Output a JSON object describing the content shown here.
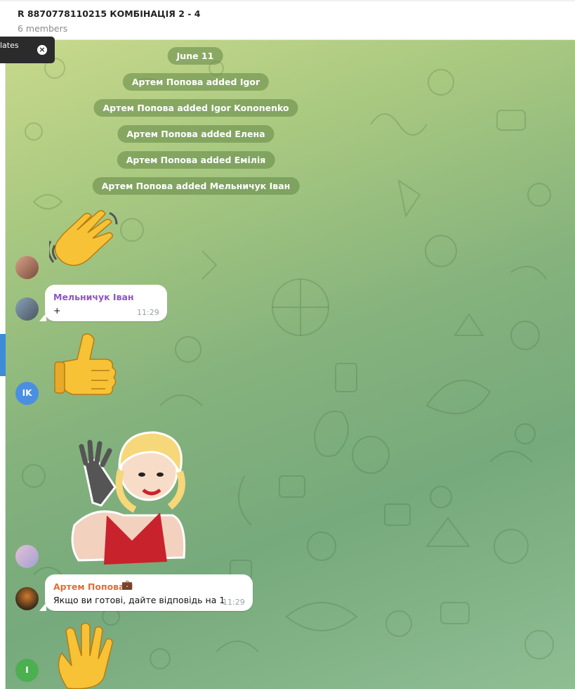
{
  "header": {
    "title": "R 8870778110215 КОМБІНАЦІЯ 2 - 4",
    "subtitle": "6 members"
  },
  "toast": {
    "text": "lates",
    "close_icon": "close-icon"
  },
  "service_messages": [
    "June 11",
    "Артем Попова added Igor",
    "Артем Попова added Igor Kononenko",
    "Артем Попова added Елена",
    "Артем Попова added Емілія",
    "Артем Попова added Мельничук Іван"
  ],
  "messages": [
    {
      "type": "sticker",
      "sticker": "waving-hand-emoji"
    },
    {
      "type": "text",
      "sender": "Мельничук Іван",
      "sender_color": "#8e55c7",
      "text": "+",
      "time": "11:29"
    },
    {
      "type": "sticker",
      "sticker": "thumbs-up-emoji"
    },
    {
      "type": "sticker",
      "sticker": "waving-woman-sticker"
    },
    {
      "type": "text",
      "sender": "Артем Попова",
      "sender_badge": "briefcase-emoji",
      "sender_color": "#e06f3c",
      "text": "Якщо ви готові, дайте відповідь на 1",
      "time": "11:29"
    },
    {
      "type": "sticker",
      "sticker": "raised-hand-emoji"
    }
  ],
  "avatars": [
    {
      "name": "avatar-user-photo-1"
    },
    {
      "name": "avatar-melnychuk-ivan"
    },
    {
      "initials": "IK",
      "color": "#4a90e2"
    },
    {
      "name": "avatar-user-photo-2"
    },
    {
      "name": "avatar-artem-popova"
    },
    {
      "initials": "I",
      "color": "#4caf50"
    }
  ],
  "colors": {
    "chat_bg_top": "#c9d98c",
    "chat_bg_bottom": "#76a97c",
    "accent_blue": "#3d8bd9"
  }
}
